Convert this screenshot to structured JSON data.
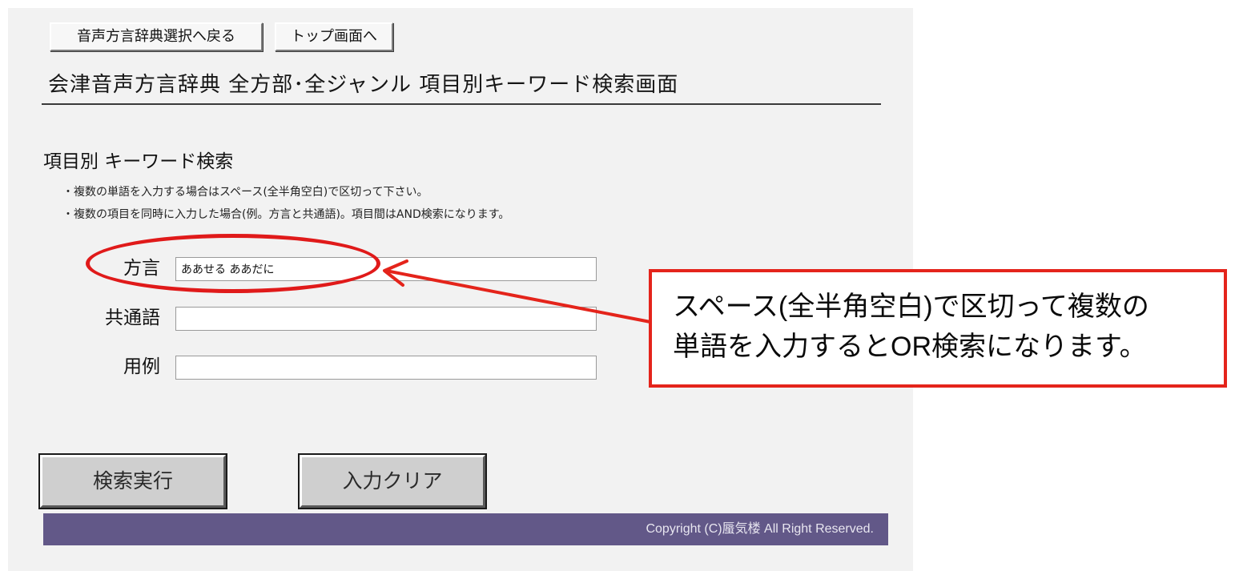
{
  "nav": {
    "back_label": "音声方言辞典選択へ戻る",
    "top_label": "トップ画面へ"
  },
  "page": {
    "title": "会津音声方言辞典 全方部･全ジャンル 項目別キーワード検索画面"
  },
  "search": {
    "heading": "項目別 キーワード検索",
    "notes": [
      "・複数の単語を入力する場合はスペース(全半角空白)で区切って下さい。",
      "・複数の項目を同時に入力した場合(例。方言と共通語)。項目間はAND検索になります。"
    ],
    "fields": [
      {
        "label": "方言",
        "value": "ああせる ああだに"
      },
      {
        "label": "共通語",
        "value": ""
      },
      {
        "label": "用例",
        "value": ""
      }
    ],
    "search_button": "検索実行",
    "clear_button": "入力クリア"
  },
  "callout": {
    "lines": [
      "スペース(全半角空白)で区切って複数の",
      "単語を入力するとOR検索になります。"
    ],
    "border_color": "#e4241b"
  },
  "footer": {
    "copyright": "Copyright (C)蜃気楼 All Right Reserved.",
    "background_color": "#625888"
  }
}
